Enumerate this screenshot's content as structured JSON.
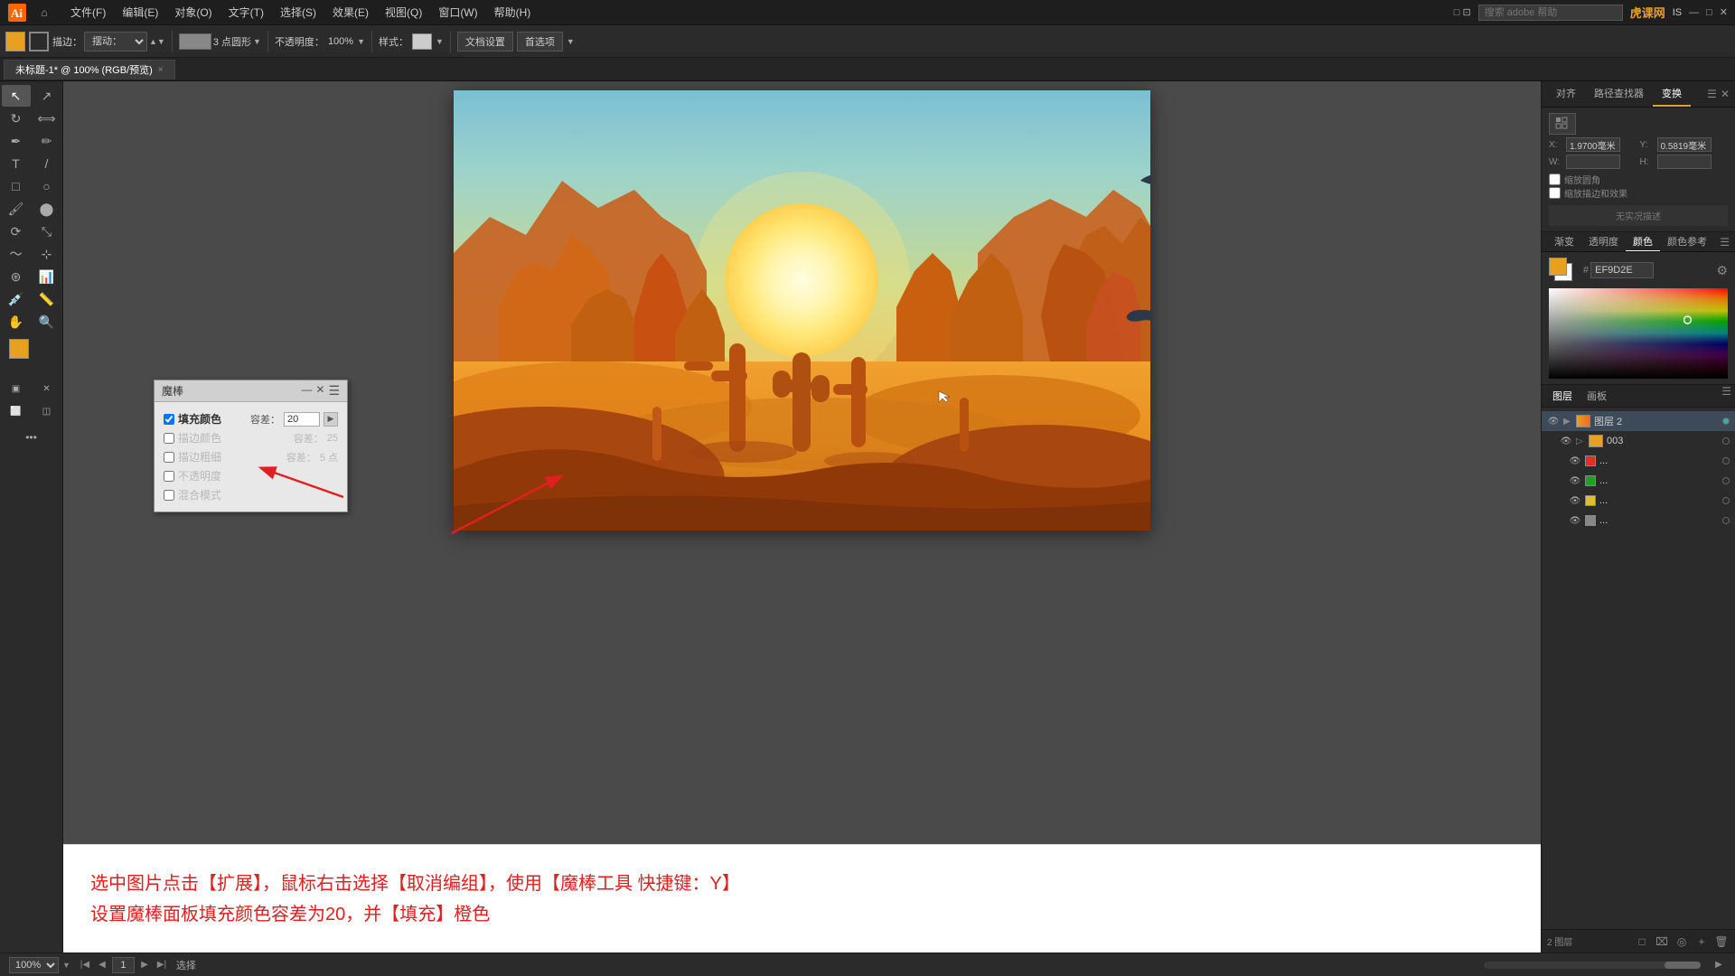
{
  "app": {
    "title": "Adobe Illustrator",
    "logo": "Ai"
  },
  "menubar": {
    "items": [
      "文件(F)",
      "编辑(E)",
      "对象(O)",
      "文字(T)",
      "选择(S)",
      "效果(E)",
      "视图(Q)",
      "窗口(W)",
      "帮助(H)"
    ],
    "search_placeholder": "搜索 adobe 帮助",
    "logo_text": "虎课网",
    "logo_sub": "IS"
  },
  "toolbar": {
    "fill_label": "填充",
    "stroke_label": "描边：",
    "wand_label": "摆动：",
    "brush_size_label": "3 点圆形",
    "opacity_label": "不透明度：",
    "opacity_value": "100%",
    "style_label": "样式：",
    "doc_settings_label": "文档设置",
    "preferences_label": "首选项"
  },
  "tab": {
    "label": "未标题-1* @ 100% (RGB/预览)",
    "close": "×"
  },
  "magic_wand_panel": {
    "title": "魔棒",
    "fill_color_label": "填充颜色",
    "fill_color_checked": true,
    "fill_tolerance_label": "容差：",
    "fill_tolerance_value": "20",
    "stroke_color_label": "描边颜色",
    "stroke_color_checked": false,
    "stroke_tolerance_label": "容差：",
    "stroke_tolerance_value": "25",
    "stroke_weight_label": "描边粗细",
    "stroke_weight_checked": false,
    "stroke_weight_tolerance_label": "容差：",
    "stroke_weight_tolerance_value": "5 点",
    "opacity_label": "不透明度",
    "opacity_checked": false,
    "opacity_tolerance_label": "容差：",
    "blend_mode_label": "混合模式",
    "blend_mode_checked": false
  },
  "annotation": {
    "line1": "选中图片点击【扩展】，鼠标右击选择【取消编组】，使用【魔棒工具 快捷键：Y】",
    "line2": "设置魔棒面板填充颜色容差为20，并【填充】橙色"
  },
  "right_panel": {
    "tabs": [
      "对齐",
      "路径查找器",
      "变换"
    ],
    "active_tab": "变换",
    "x_label": "X",
    "x_value": "1.9700 毫米",
    "y_label": "Y",
    "y_value": "0.5819 毫米",
    "w_label": "W",
    "w_value": "",
    "h_label": "H",
    "h_value": "",
    "no_selection_text": "无实况描述"
  },
  "color_panel": {
    "tabs": [
      "渐变",
      "透明度",
      "颜色",
      "颜色参考"
    ],
    "active_tab": "颜色",
    "hex_value": "EF9D2E",
    "hash": "#"
  },
  "layers_panel": {
    "tabs": [
      "图层",
      "画板"
    ],
    "active_tab": "图层",
    "items": [
      {
        "name": "图层 2",
        "expanded": true,
        "visible": true,
        "locked": false,
        "active": true
      },
      {
        "name": "003",
        "expanded": false,
        "visible": true,
        "locked": false
      },
      {
        "name": "...",
        "color": "#e03020",
        "visible": true
      },
      {
        "name": "...",
        "color": "#20a020",
        "visible": true
      },
      {
        "name": "...",
        "color": "#e0c020",
        "visible": true
      },
      {
        "name": "...",
        "color": "#888888",
        "visible": true
      }
    ],
    "bottom_label": "2 图层"
  },
  "status_bar": {
    "zoom_value": "100%",
    "page_value": "1",
    "status_text": "选择"
  }
}
